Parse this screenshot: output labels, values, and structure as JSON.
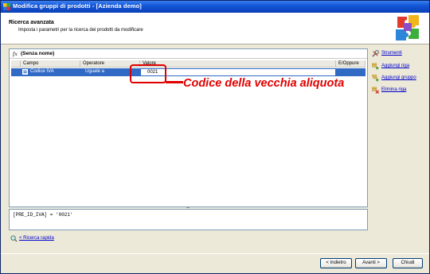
{
  "window": {
    "title": "Modifica gruppi di prodotti - [Azienda demo]"
  },
  "header": {
    "title": "Ricerca avanzata",
    "subtitle": "Imposta i parametri per la ricerca dei prodotti da modificare"
  },
  "filter": {
    "fx_icon": "fx",
    "name": "(Senza nome)",
    "columns": [
      "Campo",
      "Operatore",
      "Valore",
      "E/Oppure"
    ],
    "rows": [
      {
        "field": "Codice IVA",
        "operator": "Uguale a",
        "value": "0021",
        "andor": ""
      }
    ]
  },
  "expression": "[PRE_ID_IVA] = '0021'",
  "quick_search": "< Ricerca rapida",
  "tools": {
    "title": "Strumenti",
    "add_row": "Aggiungi riga",
    "add_group": "Aggiungi gruppo",
    "delete_row": "Elimina riga"
  },
  "buttons": {
    "back": "< Indietro",
    "next": "Avanti >",
    "close": "Chiudi"
  },
  "annotation": "Codice della vecchia aliquota",
  "colors": {
    "selection": "#316ac5",
    "annotation": "#e00000",
    "titlebar": "#1456d8"
  },
  "icons": {
    "app": "puzzle-icon",
    "header": "puzzle-pieces-icon",
    "tools": "wrench-icon",
    "add_row": "add-row-icon",
    "add_group": "add-group-icon",
    "delete_row": "delete-row-icon",
    "quick": "magnifier-icon"
  }
}
